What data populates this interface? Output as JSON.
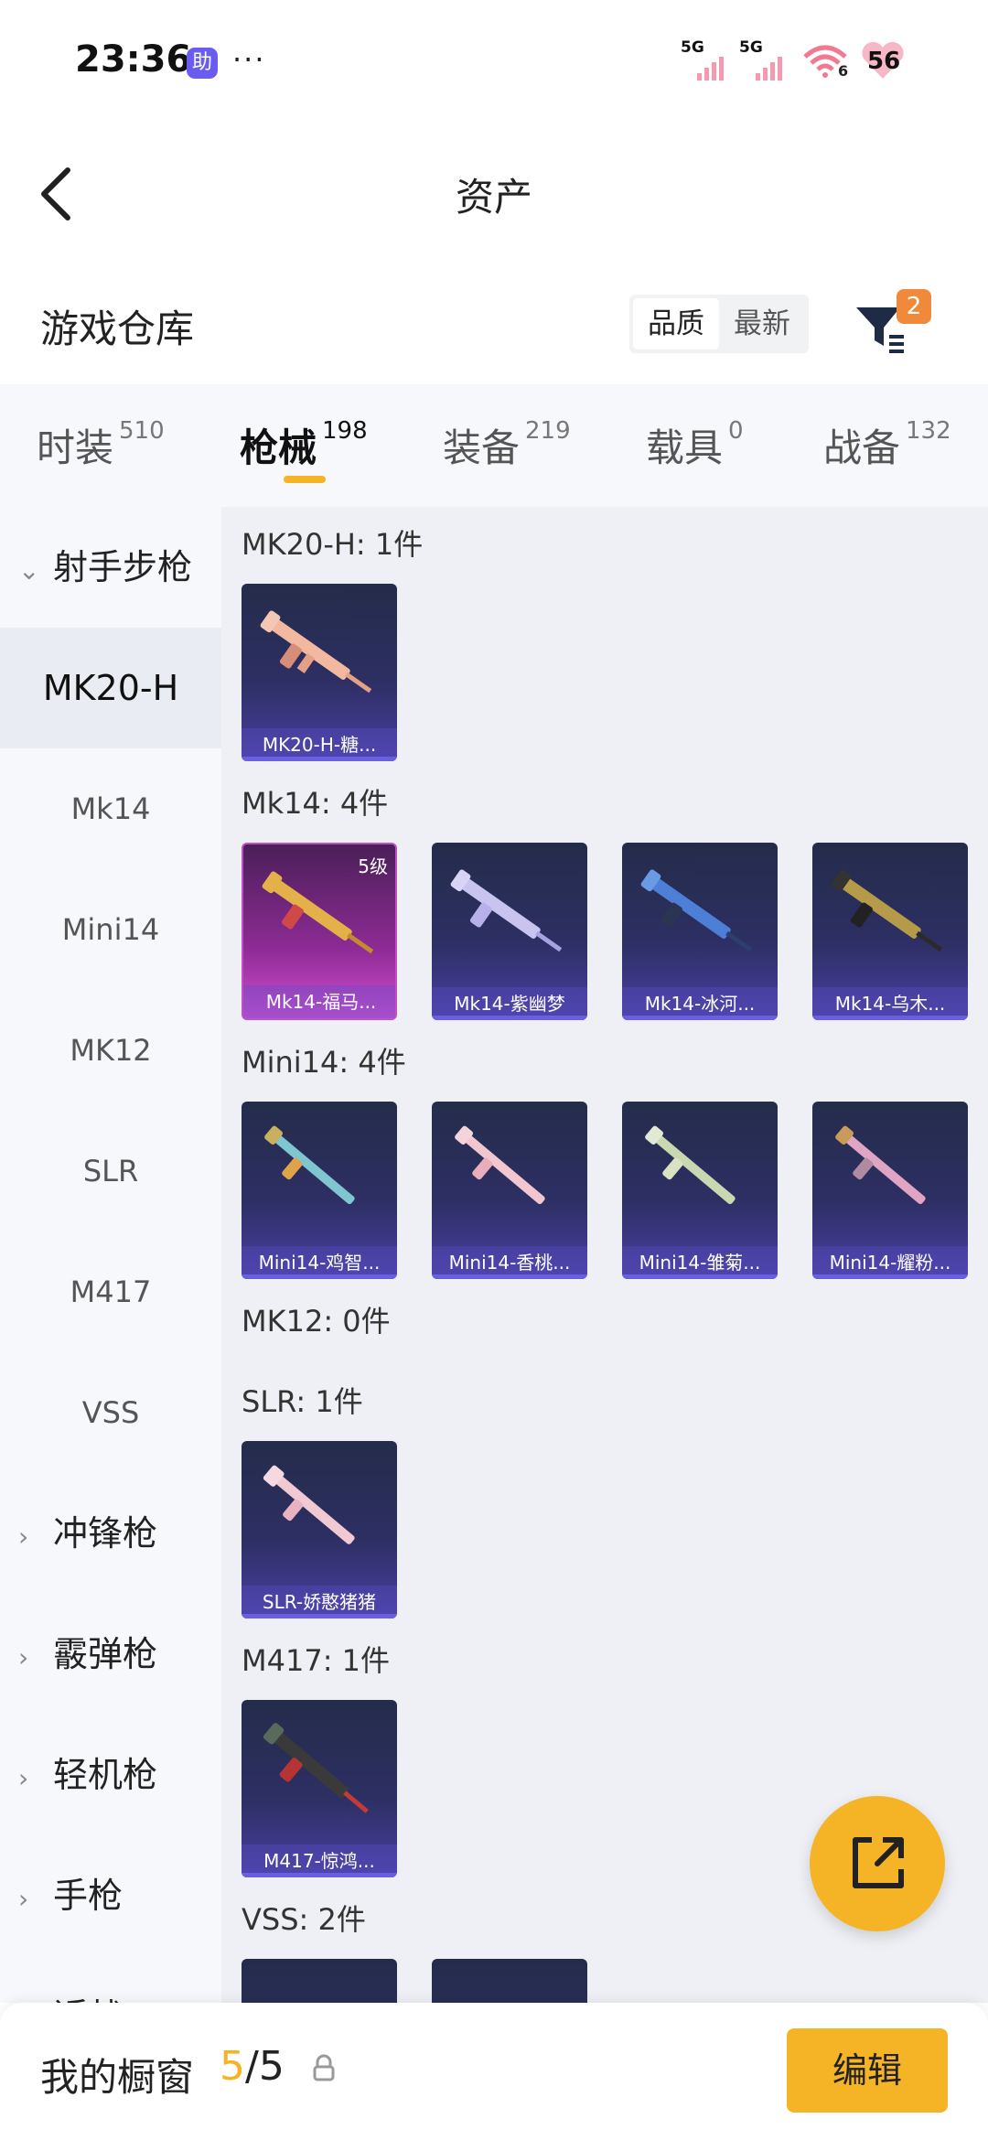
{
  "status": {
    "time": "23:36",
    "assist_badge": "助",
    "dots": "···",
    "net1": "5G",
    "net2": "5G",
    "wifi_sub": "6",
    "battery": "56"
  },
  "header": {
    "title": "资产"
  },
  "warehouse": {
    "title": "游戏仓库",
    "sort_quality": "品质",
    "sort_latest": "最新",
    "filter_badge": "2"
  },
  "tabs": [
    {
      "label": "时装",
      "count": "510"
    },
    {
      "label": "枪械",
      "count": "198"
    },
    {
      "label": "装备",
      "count": "219"
    },
    {
      "label": "载具",
      "count": "0"
    },
    {
      "label": "战备",
      "count": "132"
    }
  ],
  "sidebar": {
    "items": [
      {
        "label": "射手步枪"
      },
      {
        "label": "MK20-H"
      },
      {
        "label": "Mk14"
      },
      {
        "label": "Mini14"
      },
      {
        "label": "MK12"
      },
      {
        "label": "SLR"
      },
      {
        "label": "M417"
      },
      {
        "label": "VSS"
      },
      {
        "label": "冲锋枪"
      },
      {
        "label": "霰弹枪"
      },
      {
        "label": "轻机枪"
      },
      {
        "label": "手枪"
      },
      {
        "label": "近战"
      }
    ]
  },
  "groups": [
    {
      "title": "MK20-H: 1件",
      "items": [
        {
          "label": "MK20-H-糖..."
        }
      ]
    },
    {
      "title": "Mk14: 4件",
      "items": [
        {
          "label": "Mk14-福马...",
          "level": "5级"
        },
        {
          "label": "Mk14-紫幽梦"
        },
        {
          "label": "Mk14-冰河..."
        },
        {
          "label": "Mk14-乌木..."
        }
      ]
    },
    {
      "title": "Mini14: 4件",
      "items": [
        {
          "label": "Mini14-鸡智..."
        },
        {
          "label": "Mini14-香桃..."
        },
        {
          "label": "Mini14-雏菊..."
        },
        {
          "label": "Mini14-耀粉..."
        }
      ]
    },
    {
      "title": "MK12: 0件",
      "items": []
    },
    {
      "title": "SLR: 1件",
      "items": [
        {
          "label": "SLR-娇憨猪猪"
        }
      ]
    },
    {
      "title": "M417: 1件",
      "items": [
        {
          "label": "M417-惊鸿..."
        }
      ]
    },
    {
      "title": "VSS: 2件",
      "items": []
    }
  ],
  "showcase": {
    "label": "我的橱窗",
    "used": "5",
    "total": "/5",
    "edit": "编辑"
  },
  "colors": {
    "accent": "#f5b326",
    "card_bg": "#2d2f63",
    "card_purple": "#8e2b95",
    "badge": "#f08a3a"
  }
}
